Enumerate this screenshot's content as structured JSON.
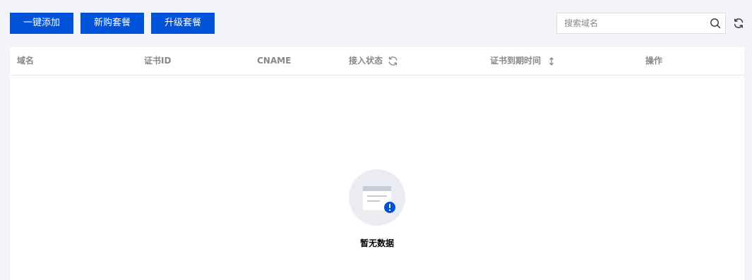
{
  "toolbar": {
    "buttons": [
      {
        "label": "一键添加"
      },
      {
        "label": "新购套餐"
      },
      {
        "label": "升级套餐"
      }
    ],
    "search": {
      "placeholder": "搜索域名",
      "value": ""
    },
    "search_icon": "search-icon",
    "refresh_icon": "refresh-icon"
  },
  "table": {
    "columns": [
      {
        "label": "域名"
      },
      {
        "label": "证书ID"
      },
      {
        "label": "CNAME"
      },
      {
        "label": "接入状态",
        "icon": "refresh-icon"
      },
      {
        "label": "证书到期时间",
        "icon": "sort-icon"
      },
      {
        "label": "操作"
      }
    ],
    "rows": [],
    "empty": {
      "text": "暂无数据",
      "icon": "empty-data-icon"
    }
  },
  "colors": {
    "primary": "#0052d9",
    "page_bg": "#f3f4f7",
    "header_text": "#888888"
  }
}
